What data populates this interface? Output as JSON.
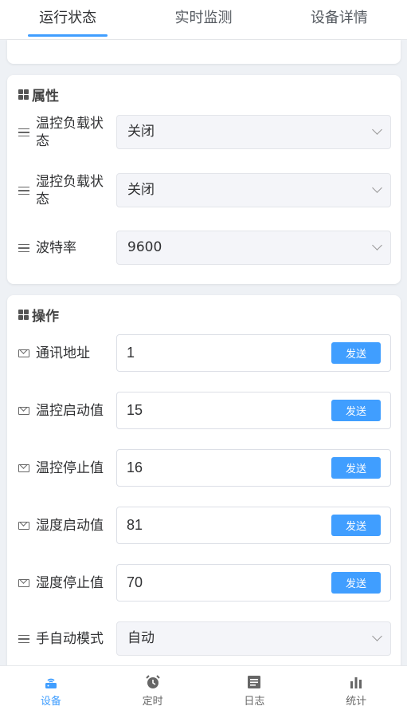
{
  "tabs": [
    {
      "label": "运行状态",
      "active": true
    },
    {
      "label": "实时监测",
      "active": false
    },
    {
      "label": "设备详情",
      "active": false
    }
  ],
  "attributes": {
    "title": "属性",
    "rows": [
      {
        "label": "温控负载状态",
        "value": "关闭"
      },
      {
        "label": "湿控负载状态",
        "value": "关闭"
      },
      {
        "label": "波特率",
        "value": "9600"
      }
    ]
  },
  "operations": {
    "title": "操作",
    "send_label": "发送",
    "inputs": [
      {
        "label": "通讯地址",
        "value": "1"
      },
      {
        "label": "温控启动值",
        "value": "15"
      },
      {
        "label": "温控停止值",
        "value": "16"
      },
      {
        "label": "湿度启动值",
        "value": "81"
      },
      {
        "label": "湿度停止值",
        "value": "70"
      }
    ],
    "mode": {
      "label": "手自动模式",
      "value": "自动"
    }
  },
  "bottom_nav": [
    {
      "label": "设备",
      "icon": "router-icon",
      "active": true
    },
    {
      "label": "定时",
      "icon": "alarm-clock-icon",
      "active": false
    },
    {
      "label": "日志",
      "icon": "log-icon",
      "active": false
    },
    {
      "label": "统计",
      "icon": "bar-chart-icon",
      "active": false
    }
  ],
  "colors": {
    "accent": "#409eff",
    "background": "#eef1f5"
  }
}
